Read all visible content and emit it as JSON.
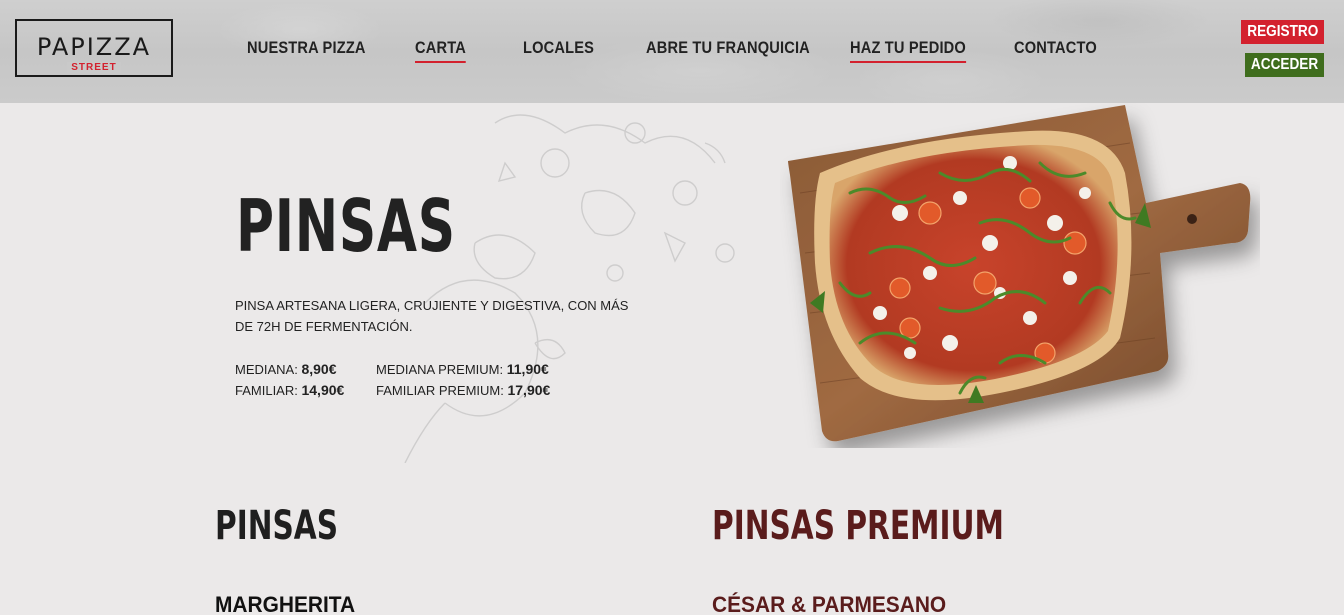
{
  "header": {
    "logo": {
      "main": "PAPIZZA",
      "sub": "STREET"
    },
    "nav": [
      {
        "label": "NUESTRA PIZZA",
        "active": false
      },
      {
        "label": "CARTA",
        "active": true
      },
      {
        "label": "LOCALES",
        "active": false
      },
      {
        "label": "ABRE TU FRANQUICIA",
        "active": false
      },
      {
        "label": "HAZ TU PEDIDO",
        "active": true
      },
      {
        "label": "CONTACTO",
        "active": false
      }
    ],
    "registro_label": "REGISTRO",
    "acceder_label": "ACCEDER"
  },
  "hero": {
    "title": "PINSAS",
    "description": "PINSA ARTESANA LIGERA, CRUJIENTE Y DIGESTIVA, CON MÁS DE 72H DE FERMENTACIÓN.",
    "prices": {
      "mediana_label": "MEDIANA:",
      "mediana_value": "8,90€",
      "mediana_premium_label": "MEDIANA PREMIUM:",
      "mediana_premium_value": "11,90€",
      "familiar_label": "FAMILIAR:",
      "familiar_value": "14,90€",
      "familiar_premium_label": "FAMILIAR PREMIUM:",
      "familiar_premium_value": "17,90€"
    }
  },
  "menu": {
    "left_section": {
      "title": "PINSAS",
      "first_item": "MARGHERITA"
    },
    "right_section": {
      "title": "PINSAS PREMIUM",
      "first_item": "CÉSAR & PARMESANO"
    }
  },
  "colors": {
    "accent_red": "#d3212e",
    "accent_green": "#3f6d1d",
    "premium_maroon": "#5a1c1c"
  }
}
